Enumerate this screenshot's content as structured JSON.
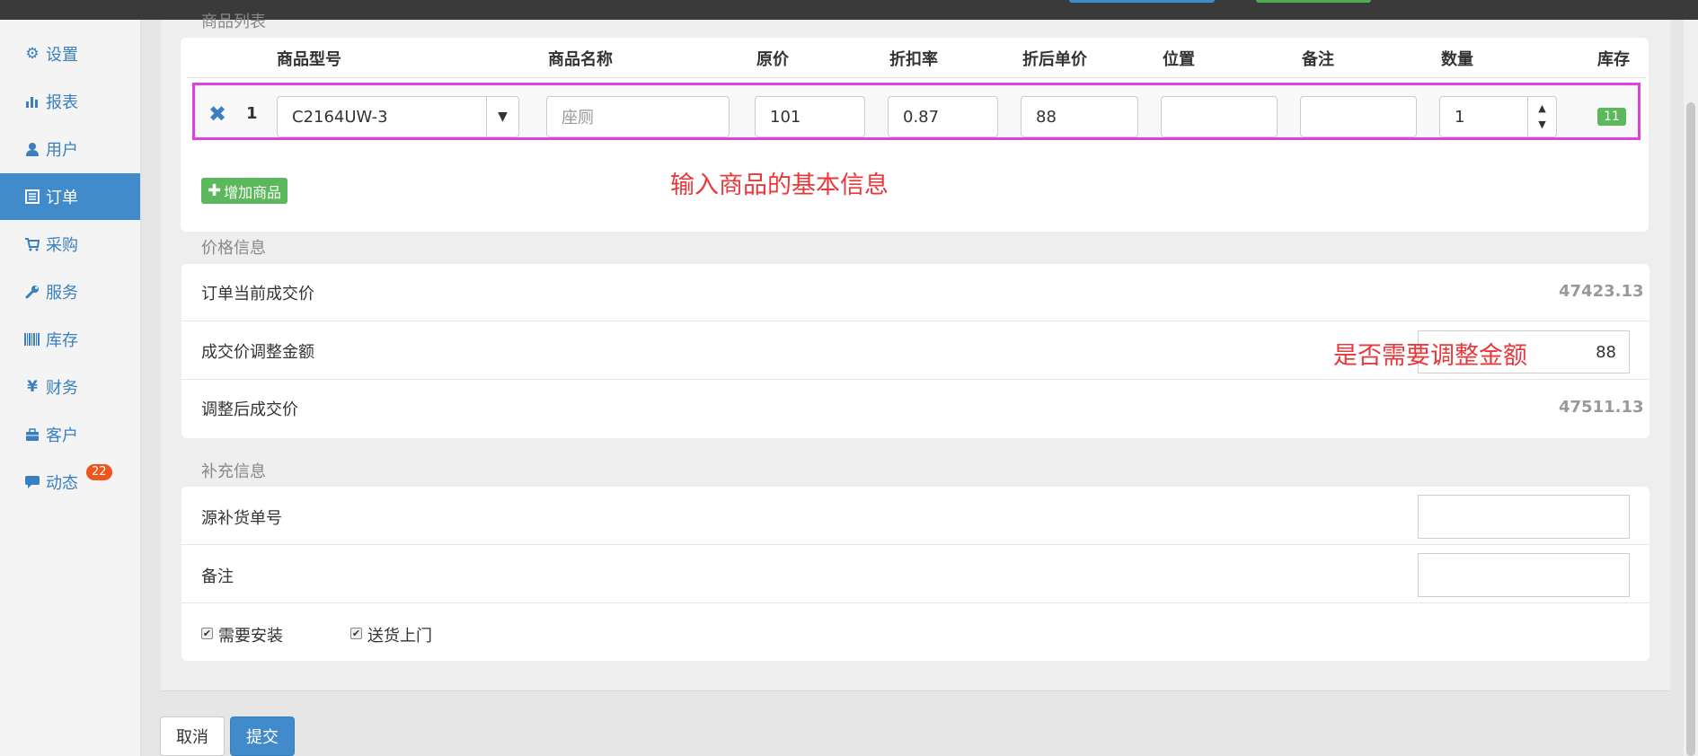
{
  "sidebar": {
    "items": [
      {
        "label": "设置",
        "icon": "gear-icon"
      },
      {
        "label": "报表",
        "icon": "bar-chart-icon"
      },
      {
        "label": "用户",
        "icon": "user-icon"
      },
      {
        "label": "订单",
        "icon": "list-icon",
        "active": true
      },
      {
        "label": "采购",
        "icon": "cart-icon"
      },
      {
        "label": "服务",
        "icon": "wrench-icon"
      },
      {
        "label": "库存",
        "icon": "barcode-icon"
      },
      {
        "label": "财务",
        "icon": "yen-icon"
      },
      {
        "label": "客户",
        "icon": "briefcase-icon"
      },
      {
        "label": "动态",
        "icon": "comment-icon",
        "badge": "22"
      }
    ]
  },
  "products": {
    "section_label": "商品列表",
    "headers": {
      "model": "商品型号",
      "name": "商品名称",
      "orig_price": "原价",
      "discount": "折扣率",
      "unit_price": "折后单价",
      "location": "位置",
      "remark": "备注",
      "qty": "数量",
      "stock": "库存"
    },
    "row": {
      "remove_icon": "✖",
      "index": "1",
      "model": "C2164UW-3",
      "name_placeholder": "座厕",
      "orig_price": "101",
      "discount": "0.87",
      "unit_price": "88",
      "location": "",
      "remark": "",
      "qty": "1",
      "stock": "11"
    },
    "add_button": "增加商品",
    "annotation": "输入商品的基本信息"
  },
  "price": {
    "section_label": "价格信息",
    "current_label": "订单当前成交价",
    "current_value": "47423.13",
    "adjust_label": "成交价调整金额",
    "adjust_value": "88",
    "adjusted_label": "调整后成交价",
    "adjusted_value": "47511.13",
    "annotation": "是否需要调整金额"
  },
  "extra": {
    "section_label": "补充信息",
    "source_label": "源补货单号",
    "source_value": "",
    "remark_label": "备注",
    "remark_value": "",
    "need_install": "需要安装",
    "deliver_home": "送货上门"
  },
  "actions": {
    "cancel": "取消",
    "submit": "提交"
  },
  "colors": {
    "accent": "#428bca",
    "link": "#3a7fc1",
    "success": "#5cb85c",
    "highlight_frame": "#e040e0",
    "annotation": "#e8383b",
    "badge": "#f0561c"
  }
}
